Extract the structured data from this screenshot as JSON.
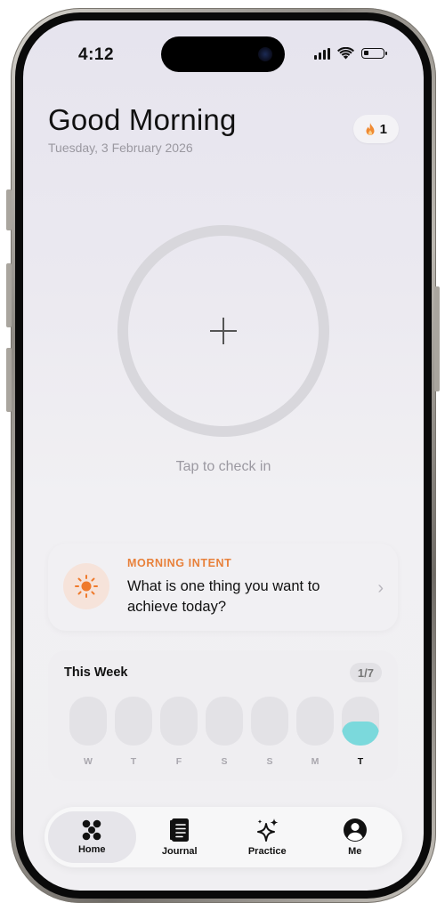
{
  "status_bar": {
    "time": "4:12",
    "battery_level": 0.25
  },
  "header": {
    "greeting": "Good Morning",
    "date": "Tuesday, 3 February 2026",
    "streak_count": "1",
    "streak_icon": "flame-icon"
  },
  "checkin": {
    "label": "Tap to check in"
  },
  "intent": {
    "tag": "MORNING INTENT",
    "question": "What is one thing you want to achieve today?",
    "icon": "sun-icon",
    "accent": "#E8813B"
  },
  "week": {
    "title": "This Week",
    "progress": "1/7",
    "days": [
      {
        "letter": "W",
        "filled": false
      },
      {
        "letter": "T",
        "filled": false
      },
      {
        "letter": "F",
        "filled": false
      },
      {
        "letter": "S",
        "filled": false
      },
      {
        "letter": "S",
        "filled": false
      },
      {
        "letter": "M",
        "filled": false
      },
      {
        "letter": "T",
        "filled": true,
        "today": true
      }
    ],
    "fill_color": "#7BD9DC"
  },
  "tabs": [
    {
      "label": "Home",
      "icon": "home-flower-icon",
      "active": true
    },
    {
      "label": "Journal",
      "icon": "journal-icon",
      "active": false
    },
    {
      "label": "Practice",
      "icon": "sparkles-icon",
      "active": false
    },
    {
      "label": "Me",
      "icon": "profile-icon",
      "active": false
    }
  ]
}
